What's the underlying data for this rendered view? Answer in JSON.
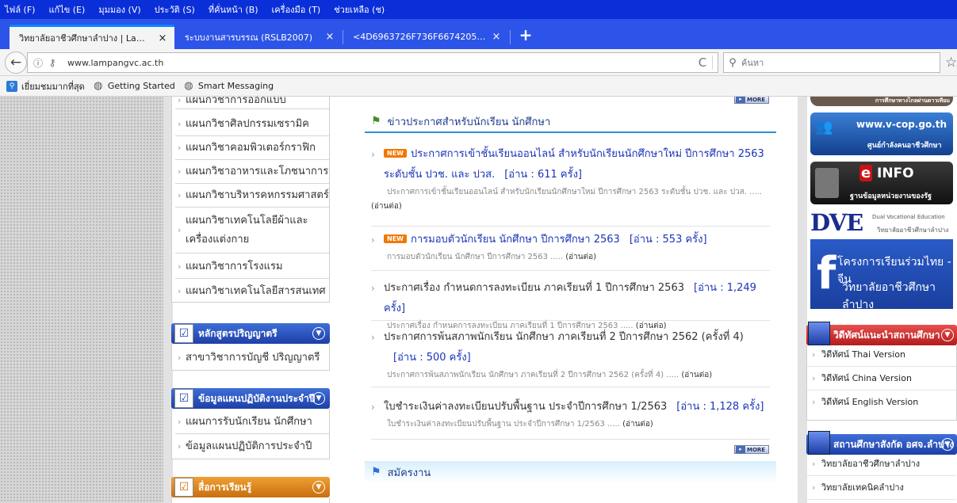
{
  "menu": [
    "ไฟล์ (F)",
    "แก้ไข (E)",
    "มุมมอง (V)",
    "ประวัติ (S)",
    "ที่คั่นหน้า (B)",
    "เครื่องมือ (T)",
    "ช่วยเหลือ (ช)"
  ],
  "tabs": [
    {
      "label": "วิทยาลัยอาชีวศึกษาลำปาง | Lampan...",
      "close": "×"
    },
    {
      "label": "ระบบงานสารบรรณ (RSLB2007)",
      "close": "×"
    },
    {
      "label": "<4D6963726F736F667420576F72...",
      "close": "×"
    }
  ],
  "new_tab": "+",
  "nav": {
    "back": "←",
    "url": "www.lampangvc.ac.th",
    "reload": "C",
    "search_placeholder": "ค้นหา",
    "star": "☆"
  },
  "bookmarks": [
    {
      "label": "เยี่ยมชมมากที่สุด",
      "icon": "most-visited-icon"
    },
    {
      "label": "Getting Started",
      "icon": "globe-icon"
    },
    {
      "label": "Smart Messaging",
      "icon": "globe-icon"
    }
  ],
  "sidebar": {
    "dept_items": [
      "แผนกวิชาการออกแบบ",
      "แผนกวิชาศิลปกรรมเซรามิค",
      "แผนกวิชาคอมพิวเตอร์กราฟิก",
      "แผนกวิชาอาหารและโภชนาการ",
      "แผนกวิชาบริหารคหกรรมศาสตร์",
      "แผนกวิชาเทคโนโลยีผ้าและเครื่องแต่งกาย",
      "แผนกวิชาการโรงแรม",
      "แผนกวิชาเทคโนโลยีสารสนเทศ"
    ],
    "bachelor": {
      "title": "หลักสูตรปริญญาตรี",
      "items": [
        "สาขาวิชาการบัญชี ปริญญาตรี"
      ]
    },
    "plan": {
      "title": "ข้อมูลแผนปฏิบัติงานประจำปี",
      "items": [
        "แผนการรับนักเรียน นักศึกษา",
        "ข้อมูลแผนปฏิบัติการประจำปี"
      ]
    },
    "media": {
      "title": "สื่อการเรียนรู้"
    }
  },
  "more_label": "MORE",
  "news": {
    "title": "ข่าวประกาศสำหรับนักเรียน นักศึกษา",
    "items": [
      {
        "new": "NEW",
        "title": "ประกาศการเข้าชั้นเรียนออนไลน์ สำหรับนักเรียนนักศึกษาใหม่ ปีการศึกษา 2563 ระดับชั้น ปวช. และ ปวส.",
        "reads": "[อ่าน : 611 ครั้ง]",
        "summary": "ประกาศการเข้าชั้นเรียนออนไลน์ สำหรับนักเรียนนักศึกษาใหม่ ปีการศึกษา 2563 ระดับชั้น ปวช. และ ปวส. .....",
        "cont": "(อ่านต่อ)"
      },
      {
        "new": "NEW",
        "title": "การมอบตัวนักเรียน นักศึกษา ปีการศึกษา 2563",
        "reads": "[อ่าน : 553 ครั้ง]",
        "summary": "การมอบตัวนักเรียน นักศึกษา ปีการศึกษา 2563 .....",
        "cont": "(อ่านต่อ)"
      },
      {
        "new": "",
        "title": "ประกาศเรื่อง กำหนดการลงทะเบียน ภาคเรียนที่ 1 ปีการศึกษา 2563",
        "reads": "[อ่าน : 1,249 ครั้ง]",
        "summary": "ประกาศเรื่อง กำหนดการลงทะเบียน ภาคเรียนที่ 1 ปีการศึกษา 2563 .....",
        "cont": "(อ่านต่อ)"
      },
      {
        "new": "",
        "title": "ประกาศการพ้นสภาพนักเรียน นักศึกษา ภาคเรียนที่ 2 ปีการศึกษา 2562 (ครั้งที่ 4)",
        "reads": "[อ่าน : 500 ครั้ง]",
        "summary": "ประกาศการพ้นสภาพนักเรียน นักศึกษา ภาคเรียนที่ 2 ปีการศึกษา 2562 (ครั้งที่ 4) .....",
        "cont": "(อ่านต่อ)"
      },
      {
        "new": "",
        "title": "ใบชำระเงินค่าลงทะเบียนปรับพื้นฐาน ประจำปีการศึกษา 1/2563",
        "reads": "[อ่าน : 1,128 ครั้ง]",
        "summary": "ใบชำระเงินค่าลงทะเบียนปรับพื้นฐาน ประจำปีการศึกษา 1/2563 .....",
        "cont": "(อ่านต่อ)"
      }
    ]
  },
  "jobs": {
    "title": "สมัครงาน"
  },
  "right": {
    "banners": {
      "distance_text": "การศึกษาทางไกลผ่านดาวเทียม",
      "vcop_url": "www.v-cop.go.th",
      "vcop_sub": "ศูนย์กำลังคนอาชีวศึกษา",
      "einfo": "INFO",
      "einfo_sub": "ฐานข้อมูลหน่วยงานของรัฐ",
      "dve_logo": "DVE",
      "dve_line1": "Dual Vocational Education",
      "dve_line2": "วิทยาลัยอาชีวศึกษาลำปาง",
      "fb_line1": "โครงการเรียนร่วมไทย - จีน",
      "fb_line2": "วิทยาลัยอาชีวศึกษาลำปาง"
    },
    "video": {
      "title": "วิดีทัศน์แนะนำสถานศึกษา",
      "items": [
        "วิดีทัศน์ Thai Version",
        "วิดีทัศน์ China Version",
        "วิดีทัศน์ English Version"
      ]
    },
    "schools": {
      "title": "สถานศึกษาสังกัด อศจ.ลำปาง",
      "items": [
        "วิทยาลัยอาชีวศึกษาลำปาง",
        "วิทยาลัยเทคนิคลำปาง"
      ]
    }
  }
}
